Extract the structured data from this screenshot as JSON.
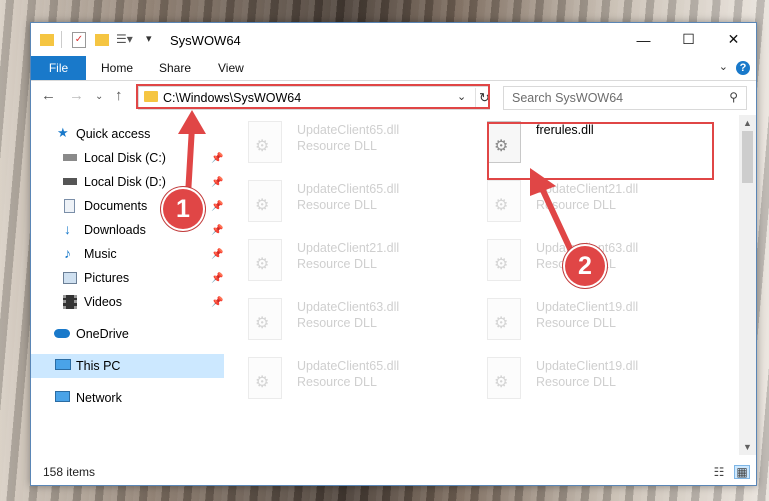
{
  "window": {
    "title": "SysWOW64",
    "controls": {
      "minimize": "—",
      "maximize": "☐",
      "close": "✕"
    }
  },
  "ribbon": {
    "file_tab": "File",
    "tabs": [
      "Home",
      "Share",
      "View"
    ],
    "help": "?"
  },
  "navigation": {
    "address": "C:\\Windows\\SysWOW64",
    "search_placeholder": "Search SysWOW64"
  },
  "sidebar": {
    "items": [
      {
        "label": "Quick access",
        "icon": "star-icon",
        "pinned": false
      },
      {
        "label": "Local Disk (C:)",
        "icon": "drive-icon",
        "pinned": true
      },
      {
        "label": "Local Disk (D:)",
        "icon": "drive-icon",
        "pinned": true
      },
      {
        "label": "Documents",
        "icon": "document-icon",
        "pinned": true
      },
      {
        "label": "Downloads",
        "icon": "download-icon",
        "pinned": true
      },
      {
        "label": "Music",
        "icon": "music-icon",
        "pinned": true
      },
      {
        "label": "Pictures",
        "icon": "pictures-icon",
        "pinned": true
      },
      {
        "label": "Videos",
        "icon": "videos-icon",
        "pinned": true
      },
      {
        "label": "OneDrive",
        "icon": "cloud-icon",
        "pinned": false
      },
      {
        "label": "This PC",
        "icon": "computer-icon",
        "pinned": false,
        "selected": true
      },
      {
        "label": "Network",
        "icon": "network-icon",
        "pinned": false
      }
    ]
  },
  "files": {
    "left_column": [
      {
        "name": "UpdateClient65.dll",
        "type": "Resource DLL"
      },
      {
        "name": "UpdateClient65.dll",
        "type": "Resource DLL"
      },
      {
        "name": "UpdateClient21.dll",
        "type": "Resource DLL"
      },
      {
        "name": "UpdateClient63.dll",
        "type": "Resource DLL"
      },
      {
        "name": "UpdateClient65.dll",
        "type": "Resource DLL"
      }
    ],
    "right_column": [
      {
        "name": "frerules.dll",
        "type": ""
      },
      {
        "name": "UpdateClient21.dll",
        "type": "Resource DLL"
      },
      {
        "name": "UpdateClient63.dll",
        "type": "Resource DLL"
      },
      {
        "name": "UpdateClient19.dll",
        "type": "Resource DLL"
      },
      {
        "name": "UpdateClient19.dll",
        "type": "Resource DLL"
      }
    ]
  },
  "status": {
    "item_count": "158 items"
  },
  "annotations": {
    "step1": "1",
    "step2": "2",
    "color": "#e04646"
  },
  "colors": {
    "accent": "#1979ca",
    "selected": "#cce8ff",
    "highlight": "#e04646"
  }
}
